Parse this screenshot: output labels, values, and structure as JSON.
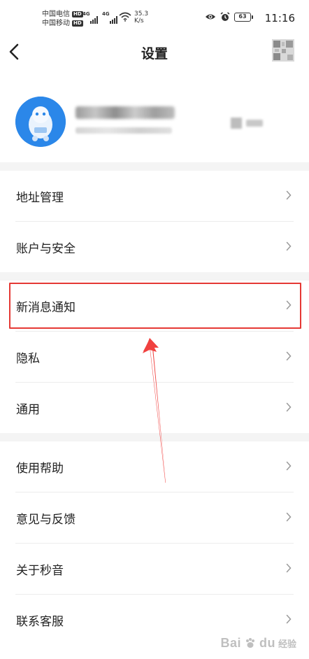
{
  "status_bar": {
    "carrier_1": "中国电信",
    "carrier_2": "中国移动",
    "hd_badge": "HD",
    "network_1": "4G",
    "network_2": "4G",
    "net_speed_value": "35.3",
    "net_speed_unit": "K/s",
    "battery": "63",
    "time": "11:16"
  },
  "header": {
    "title": "设置",
    "back_icon": "chevron-left-icon",
    "qr_icon": "qr-code-icon"
  },
  "menu": {
    "group_1": [
      {
        "label": "地址管理"
      },
      {
        "label": "账户与安全"
      }
    ],
    "group_2": [
      {
        "label": "新消息通知"
      },
      {
        "label": "隐私"
      },
      {
        "label": "通用"
      }
    ],
    "group_3": [
      {
        "label": "使用帮助"
      },
      {
        "label": "意见与反馈"
      },
      {
        "label": "关于秒音"
      },
      {
        "label": "联系客服"
      }
    ]
  },
  "annotation": {
    "highlight_color": "#e53935",
    "arrow_color": "#f0413f"
  },
  "watermark": {
    "brand": "Bai",
    "brand_suffix": "du",
    "sub": "经验"
  }
}
